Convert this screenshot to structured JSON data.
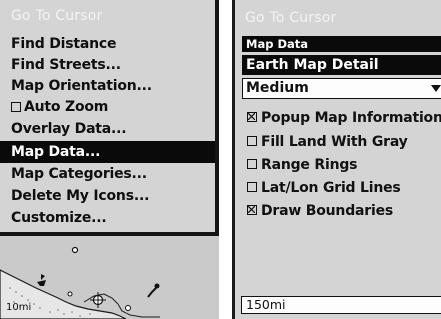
{
  "left_menu": {
    "items": [
      {
        "label": "Go To Cursor",
        "state": "disabled"
      },
      {
        "label": "Find Distance",
        "state": "normal"
      },
      {
        "label": "Find Streets...",
        "state": "normal"
      },
      {
        "label": "Map Orientation...",
        "state": "normal"
      },
      {
        "label": "Auto Zoom",
        "state": "checkbox-unchecked"
      },
      {
        "label": "Overlay Data...",
        "state": "normal"
      },
      {
        "label": "Map Data...",
        "state": "selected"
      },
      {
        "label": "Map Categories...",
        "state": "normal"
      },
      {
        "label": "Delete My Icons...",
        "state": "normal"
      },
      {
        "label": "Customize...",
        "state": "normal"
      }
    ]
  },
  "left_map": {
    "scale": "10mi"
  },
  "right_panel": {
    "title": "Go To Cursor",
    "section": "Map Data",
    "detail_label": "Earth Map Detail",
    "detail_value": "Medium",
    "options": [
      {
        "label": "Popup Map Information",
        "checked": true
      },
      {
        "label": "Fill Land With Gray",
        "checked": false
      },
      {
        "label": "Range Rings",
        "checked": false
      },
      {
        "label": "Lat/Lon Grid Lines",
        "checked": false
      },
      {
        "label": "Draw Boundaries",
        "checked": true
      }
    ],
    "scale": "150mi"
  },
  "colors": {
    "screen_bg": "#d4d4d4",
    "highlight": "#0a0a0a",
    "disabled_text": "#f4f4f4"
  }
}
